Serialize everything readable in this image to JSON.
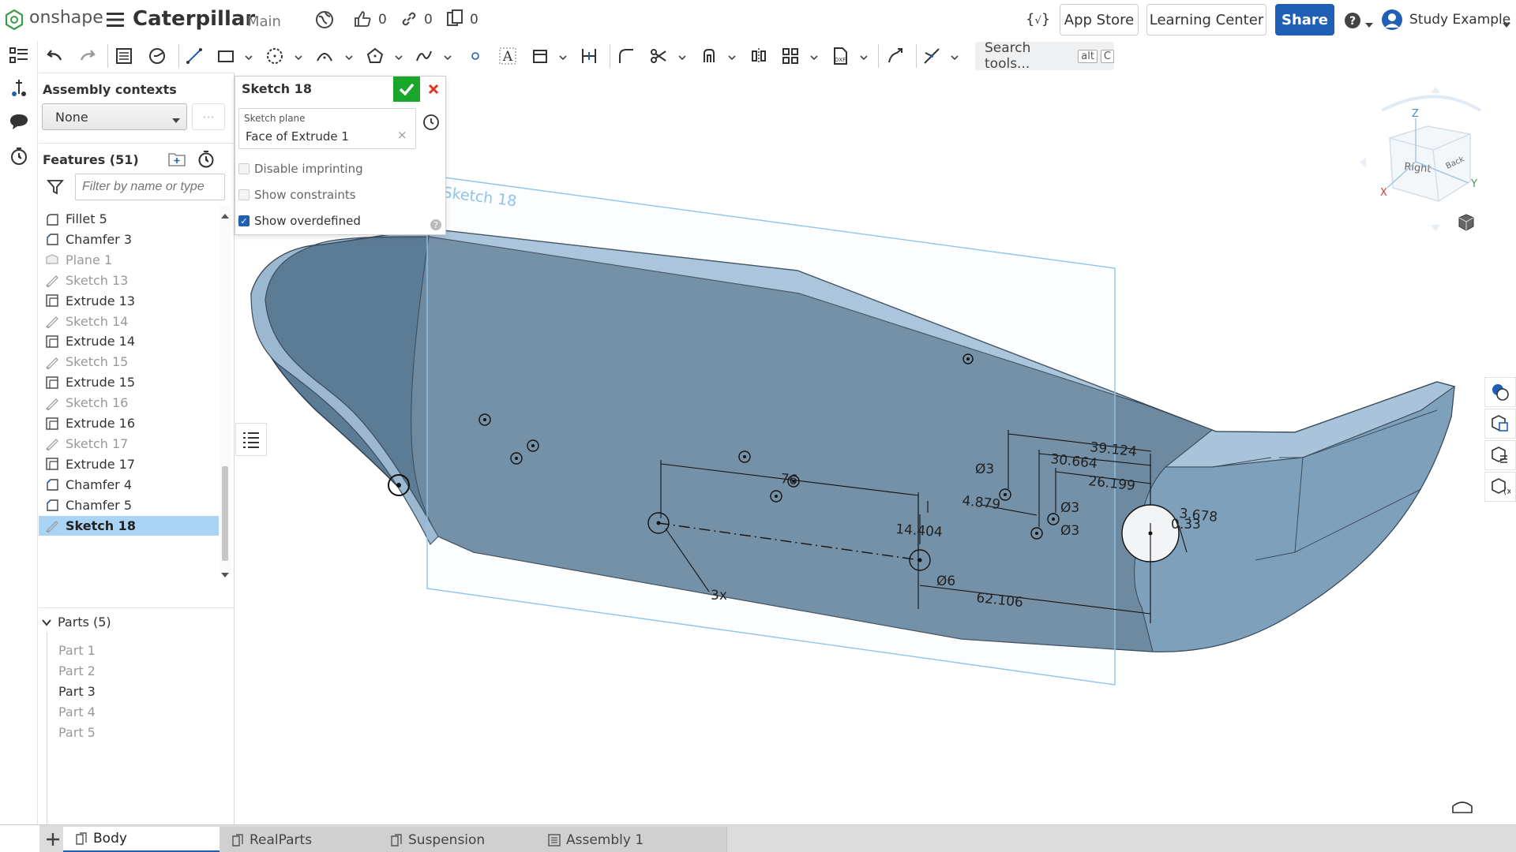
{
  "header": {
    "logo_text": "onshape",
    "doc_title": "Caterpillar",
    "workspace": "Main",
    "likes": "0",
    "links": "0",
    "copies": "0",
    "app_store": "App Store",
    "learning_center": "Learning Center",
    "share": "Share",
    "user_name": "Study Example"
  },
  "toolbar": {
    "search_placeholder": "Search tools...",
    "search_key1": "alt",
    "search_key2": "C"
  },
  "assembly_contexts": {
    "heading": "Assembly contexts",
    "selected": "None",
    "more": "···"
  },
  "features": {
    "heading": "Features (51)",
    "filter_placeholder": "Filter by name or type",
    "items": [
      {
        "label": "Fillet 5",
        "type": "fillet",
        "state": "normal"
      },
      {
        "label": "Chamfer 3",
        "type": "chamfer",
        "state": "normal"
      },
      {
        "label": "Plane 1",
        "type": "plane",
        "state": "dim"
      },
      {
        "label": "Sketch 13",
        "type": "sketch",
        "state": "dim"
      },
      {
        "label": "Extrude 13",
        "type": "extrude",
        "state": "normal"
      },
      {
        "label": "Sketch 14",
        "type": "sketch",
        "state": "dim"
      },
      {
        "label": "Extrude 14",
        "type": "extrude",
        "state": "normal"
      },
      {
        "label": "Sketch 15",
        "type": "sketch",
        "state": "dim"
      },
      {
        "label": "Extrude 15",
        "type": "extrude",
        "state": "normal"
      },
      {
        "label": "Sketch 16",
        "type": "sketch",
        "state": "dim"
      },
      {
        "label": "Extrude 16",
        "type": "extrude",
        "state": "normal"
      },
      {
        "label": "Sketch 17",
        "type": "sketch",
        "state": "dim"
      },
      {
        "label": "Extrude 17",
        "type": "extrude",
        "state": "normal"
      },
      {
        "label": "Chamfer 4",
        "type": "chamfer",
        "state": "normal"
      },
      {
        "label": "Chamfer 5",
        "type": "chamfer",
        "state": "normal"
      },
      {
        "label": "Sketch 18",
        "type": "sketch",
        "state": "selected"
      }
    ]
  },
  "parts": {
    "heading": "Parts (5)",
    "items": [
      {
        "label": "Part 1",
        "active": false
      },
      {
        "label": "Part 2",
        "active": false
      },
      {
        "label": "Part 3",
        "active": true
      },
      {
        "label": "Part 4",
        "active": false
      },
      {
        "label": "Part 5",
        "active": false
      }
    ]
  },
  "sketch_dialog": {
    "title": "Sketch 18",
    "plane_label": "Sketch plane",
    "plane_value": "Face of Extrude 1",
    "disable_imprinting": "Disable imprinting",
    "show_constraints": "Show constraints",
    "show_overdefined": "Show overdefined",
    "disable_imprinting_checked": false,
    "show_constraints_checked": false,
    "show_overdefined_checked": true,
    "help": "?"
  },
  "viewport": {
    "sketch_label": "Sketch 18",
    "dimensions": [
      "39.124",
      "30.664",
      "26.199",
      "76",
      "Ø3",
      "4.879",
      "Ø3",
      "Ø3",
      "3.678",
      "0.33",
      "14.404",
      "Ø6",
      "62.106",
      "3x"
    ],
    "view_cube": {
      "top": "Z",
      "front": "Right",
      "back": "Back",
      "x_axis": "X",
      "y_axis": "Y"
    },
    "body_color": "#6f8aa0",
    "top_color": "#8fb0cb"
  },
  "tabs": [
    {
      "label": "Body",
      "active": true
    },
    {
      "label": "RealParts",
      "active": false
    },
    {
      "label": "Suspension",
      "active": false
    },
    {
      "label": "Assembly 1",
      "active": false
    }
  ],
  "colors": {
    "accent": "#1f5fb5",
    "confirm": "#1aa52b",
    "cancel": "#e0361b",
    "selection": "#a9d4f5"
  }
}
